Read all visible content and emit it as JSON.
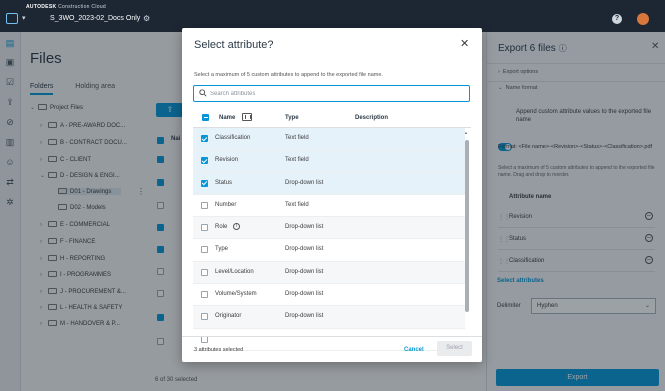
{
  "topbar": {
    "brand_prefix": "AUTODESK",
    "brand_suffix": "Construction Cloud",
    "project_name": "S_3WO_2023-02_Docs Only"
  },
  "files": {
    "title": "Files",
    "tabs": [
      "Folders",
      "Holding area"
    ],
    "tree": [
      {
        "label": "Project Files",
        "indent": 0,
        "expanded": true
      },
      {
        "label": "A - PRE-AWARD DOC...",
        "indent": 1
      },
      {
        "label": "B - CONTRACT DOCU...",
        "indent": 1
      },
      {
        "label": "C - CLIENT",
        "indent": 1
      },
      {
        "label": "D - DESIGN & ENGI...",
        "indent": 1,
        "expanded": true
      },
      {
        "label": "D01 - Drawings",
        "indent": 2,
        "selected": true
      },
      {
        "label": "D02 - Models",
        "indent": 2
      },
      {
        "label": "E - COMMERCIAL",
        "indent": 1
      },
      {
        "label": "F - FINANCE",
        "indent": 1
      },
      {
        "label": "H - REPORTING",
        "indent": 1
      },
      {
        "label": "I - PROGRAMMES",
        "indent": 1
      },
      {
        "label": "J - PROCUREMENT &...",
        "indent": 1
      },
      {
        "label": "L - HEALTH & SAFETY",
        "indent": 1
      },
      {
        "label": "M - HANDOVER & P...",
        "indent": 1
      }
    ],
    "column_name": "Nai",
    "selected_count": "6 of 30 selected"
  },
  "export_panel": {
    "title": "Export 6 files",
    "export_options": "Export options",
    "name_format": "Name format",
    "toggle_label": "Append custom attribute values to the exported file name",
    "format_text": "Format: <File name>-<Revision>-<Status>-<Classification>.pdf",
    "help_text": "Select a maximum of 5 custom attributes to append to the exported file name. Drag and drop to reorder.",
    "attribute_header": "Attribute name",
    "attributes": [
      "Revision",
      "Status",
      "Classification"
    ],
    "select_link": "Select attributes",
    "delimiter_label": "Delimiter",
    "delimiter_value": "Hyphen",
    "export_button": "Export"
  },
  "modal": {
    "title": "Select attribute?",
    "description": "Select a maximum of 5 custom attributes to append to the exported file name.",
    "search_placeholder": "Search attributes",
    "col_name": "Name",
    "col_type": "Type",
    "col_description": "Description",
    "rows": [
      {
        "name": "Classification",
        "type": "Text field",
        "checked": true
      },
      {
        "name": "Revision",
        "type": "Text field",
        "checked": true
      },
      {
        "name": "Status",
        "type": "Drop-down list",
        "checked": true
      },
      {
        "name": "Number",
        "type": "Text field",
        "checked": false
      },
      {
        "name": "Role",
        "type": "Drop-down list",
        "checked": false,
        "info": true
      },
      {
        "name": "Type",
        "type": "Drop-down list",
        "checked": false
      },
      {
        "name": "Level/Location",
        "type": "Drop-down list",
        "checked": false
      },
      {
        "name": "Volume/System",
        "type": "Drop-down list",
        "checked": false
      },
      {
        "name": "Originator",
        "type": "Drop-down list",
        "checked": false
      }
    ],
    "footer_count": "3 attributes selected",
    "cancel_label": "Cancel",
    "select_label": "Select"
  },
  "colors": {
    "accent": "#0696d7",
    "topbar": "#1d2733"
  }
}
